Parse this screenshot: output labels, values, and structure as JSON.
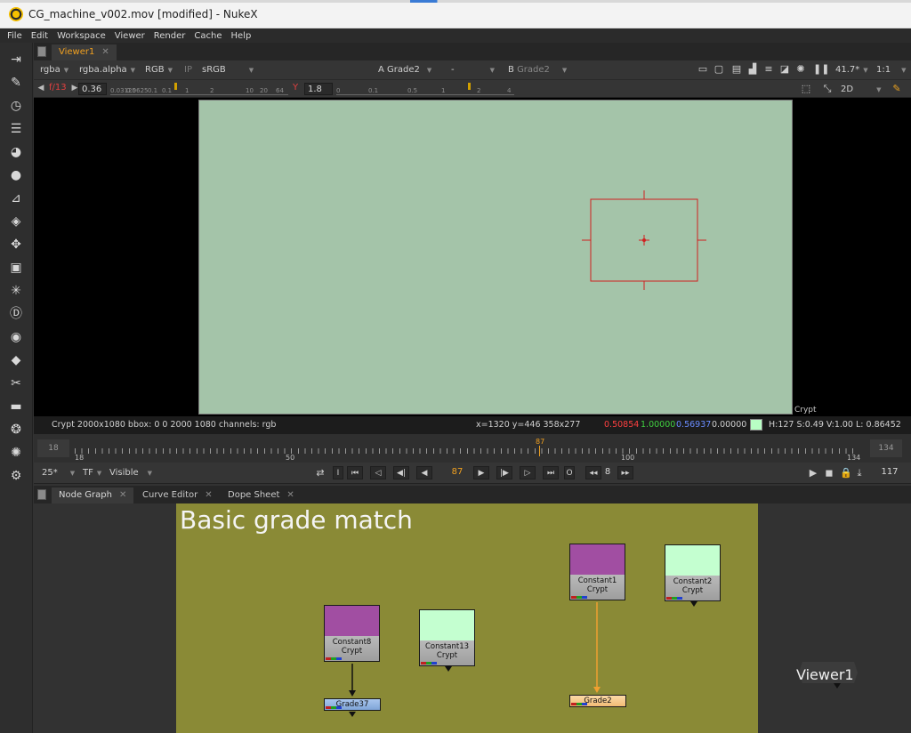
{
  "window": {
    "title": "CG_machine_v002.mov [modified] - NukeX"
  },
  "menu": [
    "File",
    "Edit",
    "Workspace",
    "Viewer",
    "Render",
    "Cache",
    "Help"
  ],
  "left_toolbar": [
    "toolbar-pin-icon",
    "pencil-icon",
    "clock-icon",
    "layers-stack-icon",
    "color-wheel-icon",
    "circle-icon",
    "channel-icon",
    "layers-icon",
    "move-icon",
    "cube-icon",
    "particles-icon",
    "deep-icon",
    "eye-icon",
    "tag-icon",
    "wrench-icon",
    "toolsets-icon",
    "keyer-icon",
    "other-icon",
    "settings-icon"
  ],
  "viewer": {
    "tab": "Viewer1",
    "channels": "rgba",
    "alpha": "rgba.alpha",
    "display": "RGB",
    "ip": "IP",
    "colorspace": "sRGB",
    "a_label": "A",
    "a_input": "Grade2",
    "mode": "-",
    "b_label": "B",
    "b_input": "Grade2",
    "zoom": "41.7*",
    "proxy": "1:1",
    "fstop": "f/13",
    "gain": "0.36",
    "gamma_label": "Y",
    "gamma": "1.8",
    "view_mode": "2D",
    "gain_ticks": [
      "0.03125",
      "0.0625",
      "0.1",
      "0.1",
      "1",
      "2",
      "10",
      "20",
      "64"
    ],
    "gamma_ticks": [
      "0",
      "0.1",
      "0.5",
      "1",
      "2",
      "4"
    ],
    "corner_label": "Crypt",
    "frame_color": "#a4c4a9"
  },
  "infobar": {
    "format": "Crypt 2000x1080  bbox: 0 0 2000 1080 channels: rgb",
    "coords": "x=1320 y=446 358x277",
    "r": "0.50854",
    "g": "1.00000",
    "b": "0.56937",
    "a": "0.00000",
    "swatch_color": "#b8ffc4",
    "hsv": "H:127 S:0.49 V:1.00  L: 0.86452"
  },
  "timeline": {
    "in": "18",
    "out": "134",
    "start_label": "18",
    "label_50": "50",
    "label_100": "100",
    "end_label": "134",
    "current": "87",
    "fps": "25*",
    "tf": "TF",
    "visible": "Visible",
    "frame_field": "87",
    "step": "8",
    "last_frame": "117"
  },
  "node_graph": {
    "tabs": [
      "Node Graph",
      "Curve Editor",
      "Dope Sheet"
    ],
    "backdrop_title": "Basic grade match",
    "nodes": {
      "constant8": {
        "name": "Constant8",
        "sub": "Crypt",
        "color": "#a14ea2"
      },
      "constant13": {
        "name": "Constant13",
        "sub": "Crypt",
        "color": "#c4ffd0"
      },
      "constant1": {
        "name": "Constant1",
        "sub": "Crypt",
        "color": "#a14ea2"
      },
      "constant2": {
        "name": "Constant2",
        "sub": "Crypt",
        "color": "#c4ffd0"
      },
      "grade37": {
        "name": "Grade37",
        "color": "#8ab0e0"
      },
      "grade2": {
        "name": "Grade2",
        "color": "#f7c98a"
      },
      "viewer1": {
        "name": "Viewer1"
      }
    }
  }
}
